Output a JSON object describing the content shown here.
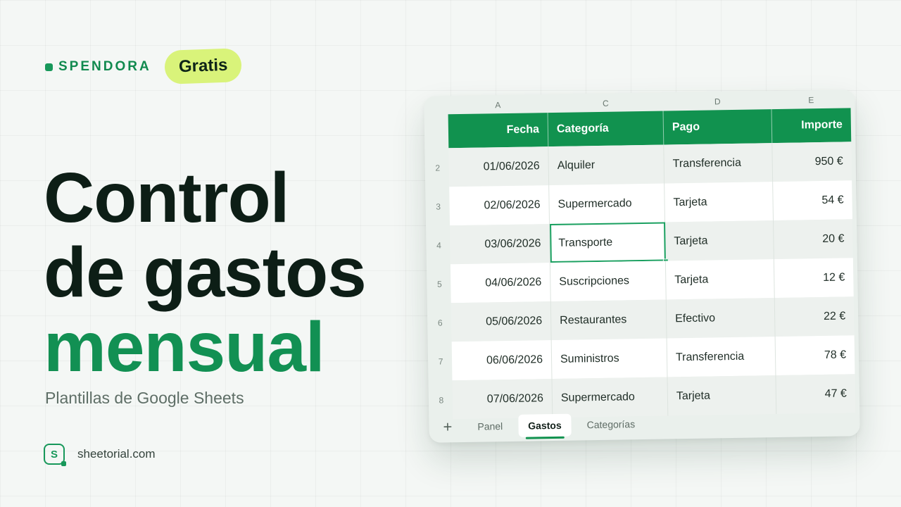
{
  "brand": {
    "name": "SPENDORA",
    "badge": "Gratis"
  },
  "headline": {
    "line1": "Control",
    "line2": "de gastos",
    "line3": "mensual"
  },
  "subtitle": "Plantillas de Google Sheets",
  "footer": {
    "logo_letter": "S",
    "url": "sheetorial.com"
  },
  "colors": {
    "accent": "#129053",
    "badge": "#d9f37a",
    "header": "#11924f"
  },
  "sheet": {
    "column_letters": [
      "A",
      "C",
      "D",
      "E"
    ],
    "headers": [
      "Fecha",
      "Categoría",
      "Pago",
      "Importe"
    ],
    "rows": [
      {
        "num": "2",
        "fecha": "01/06/2026",
        "categoria": "Alquiler",
        "pago": "Transferencia",
        "importe": "950 €"
      },
      {
        "num": "3",
        "fecha": "02/06/2026",
        "categoria": "Supermercado",
        "pago": "Tarjeta",
        "importe": "54 €"
      },
      {
        "num": "4",
        "fecha": "03/06/2026",
        "categoria": "Transporte",
        "pago": "Tarjeta",
        "importe": "20 €"
      },
      {
        "num": "5",
        "fecha": "04/06/2026",
        "categoria": "Suscripciones",
        "pago": "Tarjeta",
        "importe": "12 €"
      },
      {
        "num": "6",
        "fecha": "05/06/2026",
        "categoria": "Restaurantes",
        "pago": "Efectivo",
        "importe": "22 €"
      },
      {
        "num": "7",
        "fecha": "06/06/2026",
        "categoria": "Suministros",
        "pago": "Transferencia",
        "importe": "78 €"
      },
      {
        "num": "8",
        "fecha": "07/06/2026",
        "categoria": "Supermercado",
        "pago": "Tarjeta",
        "importe": "47 €"
      }
    ],
    "tabs": [
      "Panel",
      "Gastos",
      "Categorías"
    ],
    "active_tab": "Gastos",
    "add_tab_icon": "plus-icon"
  }
}
